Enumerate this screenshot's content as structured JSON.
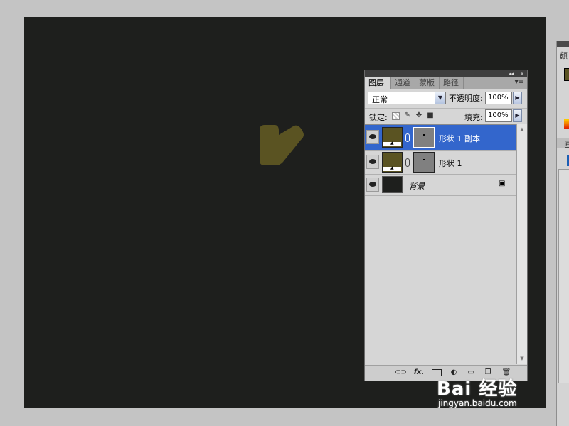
{
  "canvas": {
    "background": "#1e1f1d",
    "shape_color": "#5a5322"
  },
  "layers_panel": {
    "title_buttons": {
      "collapse": "◂◂",
      "close": "x"
    },
    "tabs": [
      {
        "label": "图层",
        "active": true
      },
      {
        "label": "通道",
        "active": false
      },
      {
        "label": "蒙版",
        "active": false
      },
      {
        "label": "路径",
        "active": false
      }
    ],
    "menu_glyph": "▾≡",
    "blend_mode": "正常",
    "opacity_label": "不透明度:",
    "opacity_value": "100%",
    "lock_label": "锁定:",
    "fill_label": "填充:",
    "fill_value": "100%",
    "layers": [
      {
        "name": "形状 1 副本",
        "selected": true,
        "type": "shape"
      },
      {
        "name": "形状 1",
        "selected": false,
        "type": "shape"
      },
      {
        "name": "背景",
        "selected": false,
        "type": "background"
      }
    ],
    "bottom_icons": [
      "link-icon",
      "fx-icon",
      "mask-icon",
      "adjustment-icon",
      "group-icon",
      "new-layer-icon",
      "trash-icon"
    ],
    "fx_label": "fx."
  },
  "right_panel": {
    "title_fragment": "颜",
    "tab_fragment": "画"
  },
  "watermark": {
    "main": "Bai 经验",
    "sub": "jingyan.baidu.com"
  },
  "colors": {
    "selection": "#3366cc",
    "panel": "#d6d6d6",
    "swatch": "#5a5322"
  }
}
